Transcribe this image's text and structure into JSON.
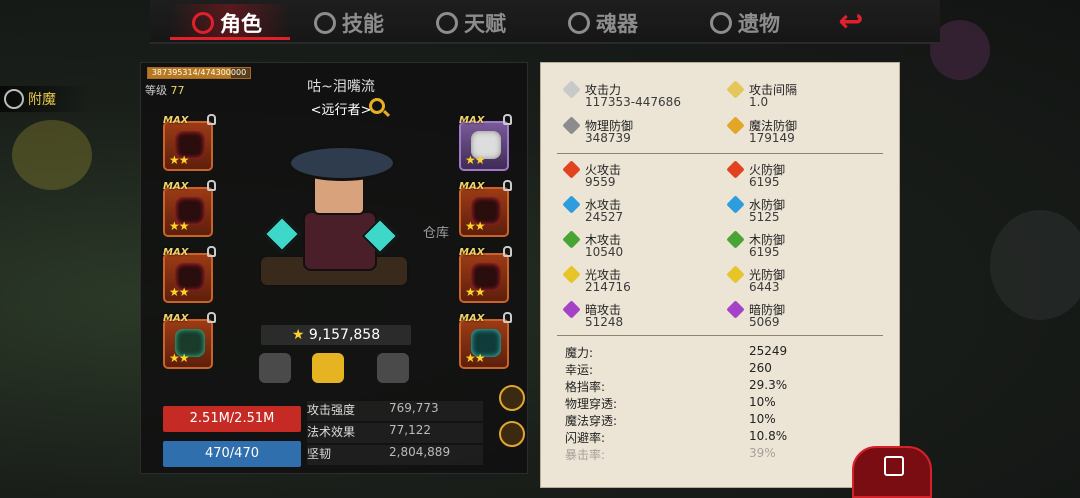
{
  "tabs": [
    {
      "label": "角色",
      "active": true
    },
    {
      "label": "技能",
      "active": false
    },
    {
      "label": "天赋",
      "active": false
    },
    {
      "label": "魂器",
      "active": false
    },
    {
      "label": "遗物",
      "active": false
    }
  ],
  "side": {
    "fumo_label": "附魔",
    "storage_label": "仓库"
  },
  "character": {
    "xp": "387395314/474300000",
    "xp_progress": 0.817,
    "level_label": "等级",
    "level": "77",
    "name": "咕~泪嘴流",
    "title": "<远行者>",
    "power": "9,157,858"
  },
  "equipment": {
    "max_label": "MAX",
    "left": [
      {
        "stars": "★★"
      },
      {
        "stars": "★★"
      },
      {
        "stars": "★★"
      },
      {
        "stars": "★★"
      }
    ],
    "right": [
      {
        "stars": "★★",
        "rarity": "purple"
      },
      {
        "stars": "★★"
      },
      {
        "stars": "★★"
      },
      {
        "stars": "★★"
      }
    ]
  },
  "vitals": {
    "hp": "2.51M/2.51M",
    "mp": "470/470",
    "hp_color": "#c62a25",
    "mp_color": "#2f6fae"
  },
  "core_stats": [
    {
      "k": "攻击强度",
      "v": "769,773"
    },
    {
      "k": "法术效果",
      "v": "77,122"
    },
    {
      "k": "坚韧",
      "v": "2,804,889"
    }
  ],
  "stats": {
    "basic": [
      {
        "name": "攻击力",
        "value": "117353-447686",
        "icon": "sword-icon",
        "color": "#c9c9c9"
      },
      {
        "name": "攻击间隔",
        "value": "1.0",
        "icon": "quill-icon",
        "color": "#e5c65a"
      },
      {
        "name": "物理防御",
        "value": "348739",
        "icon": "shield-icon",
        "color": "#8c8c8c"
      },
      {
        "name": "魔法防御",
        "value": "179149",
        "icon": "magic-shield-icon",
        "color": "#e3a629"
      }
    ],
    "elements": [
      {
        "name": "火攻击",
        "value": "9559",
        "color": "#e2421f"
      },
      {
        "name": "火防御",
        "value": "6195",
        "color": "#e2421f"
      },
      {
        "name": "水攻击",
        "value": "24527",
        "color": "#2e9de0"
      },
      {
        "name": "水防御",
        "value": "5125",
        "color": "#2e9de0"
      },
      {
        "name": "木攻击",
        "value": "10540",
        "color": "#48a533"
      },
      {
        "name": "木防御",
        "value": "6195",
        "color": "#48a533"
      },
      {
        "name": "光攻击",
        "value": "214716",
        "color": "#e8c42b"
      },
      {
        "name": "光防御",
        "value": "6443",
        "color": "#e8c42b"
      },
      {
        "name": "暗攻击",
        "value": "51248",
        "color": "#a542c7"
      },
      {
        "name": "暗防御",
        "value": "5069",
        "color": "#a542c7"
      }
    ],
    "misc": [
      {
        "k": "魔力:",
        "v": "25249"
      },
      {
        "k": "幸运:",
        "v": "260"
      },
      {
        "k": "格挡率:",
        "v": "29.3%"
      },
      {
        "k": "物理穿透:",
        "v": "10%"
      },
      {
        "k": "魔法穿透:",
        "v": "10%"
      },
      {
        "k": "闪避率:",
        "v": "10.8%"
      },
      {
        "k": "暴击率:",
        "v": "39%"
      }
    ]
  }
}
